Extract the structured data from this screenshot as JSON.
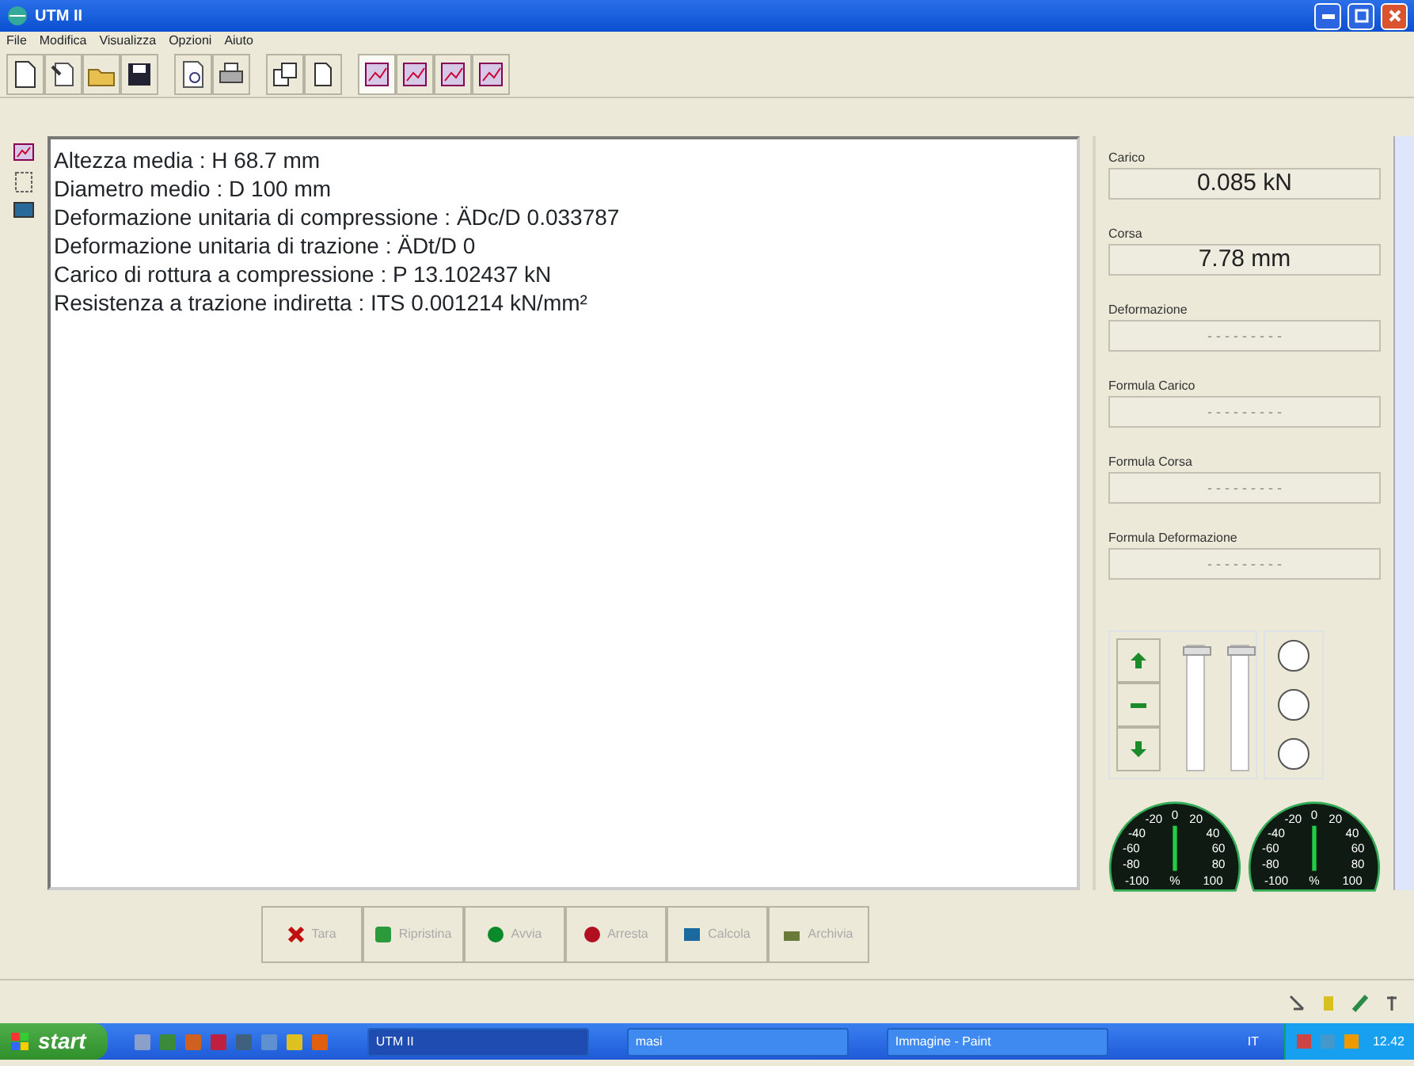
{
  "window": {
    "title": "UTM II"
  },
  "menu": [
    "File",
    "Modifica",
    "Visualizza",
    "Opzioni",
    "Aiuto"
  ],
  "toolbar": [
    {
      "kind": "new",
      "selected": false
    },
    {
      "kind": "wizard",
      "selected": false
    },
    {
      "kind": "open",
      "selected": false
    },
    {
      "kind": "save",
      "selected": false
    },
    {
      "kind": "preview",
      "selected": false
    },
    {
      "kind": "print",
      "selected": false
    },
    {
      "kind": "copy",
      "selected": false
    },
    {
      "kind": "page",
      "selected": false
    },
    {
      "kind": "chart",
      "selected": true
    },
    {
      "kind": "chart",
      "selected": false
    },
    {
      "kind": "chart",
      "selected": false
    },
    {
      "kind": "chart",
      "selected": false
    }
  ],
  "side_icons": [
    {
      "kind": "chart"
    },
    {
      "kind": "frame"
    },
    {
      "kind": "monitor"
    }
  ],
  "results": [
    "Altezza media : H 68.7 mm",
    "Diametro medio : D 100 mm",
    "Deformazione unitaria di compressione : ÄDc/D 0.033787",
    "Deformazione unitaria di trazione : ÄDt/D 0",
    "Carico di rottura a compressione : P 13.102437 kN",
    "Resistenza a trazione indiretta : ITS 0.001214 kN/mm²"
  ],
  "readouts": [
    {
      "label": "Carico",
      "value": "0.085 kN"
    },
    {
      "label": "Corsa",
      "value": "7.78 mm"
    },
    {
      "label": "Deformazione",
      "placeholder": "- - - - - - - - -"
    },
    {
      "label": "Formula Carico",
      "placeholder": "- - - - - - - - -"
    },
    {
      "label": "Formula Corsa",
      "placeholder": "- - - - - - - - -"
    },
    {
      "label": "Formula Deformazione",
      "placeholder": "- - - - - - - - -"
    }
  ],
  "jog_buttons": [
    {
      "kind": "up"
    },
    {
      "kind": "stop"
    },
    {
      "kind": "down"
    }
  ],
  "sliders": [
    {
      "level": 1
    },
    {
      "level": 1
    }
  ],
  "lamps": [
    {
      "on": false
    },
    {
      "on": false
    },
    {
      "on": false
    }
  ],
  "gauges": [
    {
      "labels": [
        "-20",
        "0",
        "20",
        "-40",
        "40",
        "-60",
        "60",
        "-80",
        "80",
        "-100",
        "%",
        "100"
      ]
    },
    {
      "labels": [
        "-20",
        "0",
        "20",
        "-40",
        "40",
        "-60",
        "60",
        "-80",
        "80",
        "-100",
        "%",
        "100"
      ]
    }
  ],
  "actions": [
    {
      "kind": "tara",
      "label": "Tara",
      "disabled": true
    },
    {
      "kind": "reset",
      "label": "Ripristina",
      "disabled": true
    },
    {
      "kind": "start",
      "label": "Avvia",
      "disabled": true
    },
    {
      "kind": "stop",
      "label": "Arresta",
      "disabled": true
    },
    {
      "kind": "calc",
      "label": "Calcola",
      "disabled": true
    },
    {
      "kind": "archive",
      "label": "Archivia",
      "disabled": true
    }
  ],
  "taskbar": {
    "start": "start",
    "quick_launch": [
      {
        "color": "#8aa0c8"
      },
      {
        "color": "#3a8a3a"
      },
      {
        "color": "#d06020"
      },
      {
        "color": "#c02040"
      },
      {
        "color": "#406080"
      },
      {
        "color": "#6090d0"
      },
      {
        "color": "#e0c020"
      },
      {
        "color": "#e06010"
      }
    ],
    "tasks": [
      {
        "label": "UTM II",
        "selected": true
      },
      {
        "label": "masi",
        "selected": false
      },
      {
        "label": "Immagine - Paint",
        "selected": false
      }
    ],
    "language": "IT",
    "clock": "12.42"
  }
}
